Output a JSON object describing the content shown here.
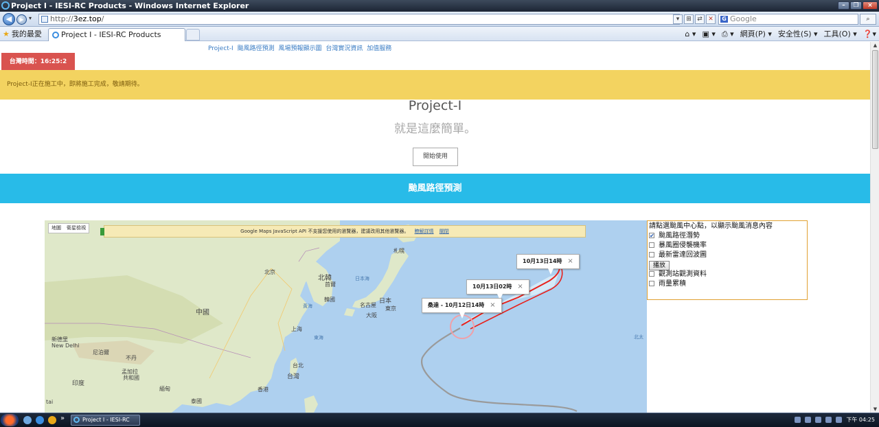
{
  "window": {
    "title": "Project I - IESI-RC Products - Windows Internet Explorer",
    "minimize": "–",
    "restore": "❐",
    "close": "×"
  },
  "browser": {
    "back_icon": "◀",
    "forward_icon": "▶",
    "address_prefix": "http://",
    "address_host": "3ez.top",
    "address_suffix": "/",
    "address_buttons": [
      "▾",
      "⊞",
      "⇄",
      "✕"
    ],
    "search_placeholder": "Google",
    "search_go": "⌕",
    "favorites_label": "我的最愛",
    "tab_title": "Project I - IESI-RC Products",
    "command_items": [
      "網頁(P) ▾",
      "安全性(S) ▾",
      "工具(O) ▾",
      "❓▾"
    ]
  },
  "page": {
    "top_nav": [
      "Project-I",
      "颱風路徑預測",
      "風場預報顯示圖",
      "台灣實況資訊",
      "加值服務"
    ],
    "clock": "台灣時間：16:25:2",
    "notice": "Project-I正在施工中，即將施工完成，敬請期待。",
    "hero_title": "Project-I",
    "hero_subtitle": "就是這麼簡單。",
    "start_button": "開始使用",
    "section_title": "颱風路徑預測"
  },
  "map": {
    "type_map": "地圖",
    "type_satellite": "衛星檢視",
    "warning": "Google Maps JavaScript API 不支援您使用的瀏覽器，建議改用其他瀏覽器。",
    "warning_link1": "瞭解詳情",
    "warning_link2": "關閉",
    "labels": {
      "china": "中國",
      "beijing": "北京",
      "north_korea": "北韓",
      "seoul": "首爾",
      "south_korea": "韓國",
      "japan": "日本",
      "tokyo": "東京",
      "nagoya": "名古屋",
      "osaka": "大阪",
      "sapporo": "札幌",
      "shanghai": "上海",
      "taipei": "台北",
      "taiwan": "台灣",
      "hongkong": "香港",
      "india": "印度",
      "newdelhi_zh": "新德里",
      "newdelhi_en": "New Delhi",
      "bangladesh": "孟加拉",
      "bangladesh2": "人民",
      "bangladesh3": "共和國",
      "myanmar": "緬甸",
      "thailand": "泰國",
      "nepal": "尼泊爾",
      "bhutan": "不丹",
      "tibet": "西藏",
      "pingan": "平安",
      "sea_japan": "日本海",
      "sea_yellow": "黃海",
      "sea_east": "東海",
      "pacific": "北太",
      "tai": "tai"
    },
    "infobox": [
      {
        "text": "10月13日14時"
      },
      {
        "text": "10月13日02時"
      },
      {
        "text": "桑達 - 10月12日14時"
      }
    ],
    "close_glyph": "×",
    "colors": {
      "track_forecast": "#e8211b",
      "track_past": "#9a9a9a",
      "current_circle": "#f0a0a8"
    }
  },
  "panel": {
    "heading": "請點選颱風中心點，以顯示颱風消息內容",
    "options": [
      {
        "label": "颱風路徑潛勢",
        "checked": true
      },
      {
        "label": "暴風圈侵襲機率",
        "checked": false
      },
      {
        "label": "最新雷達回波圖",
        "checked": false
      }
    ],
    "play_button": "播放",
    "options2": [
      {
        "label": "觀測站觀測資料",
        "checked": false
      },
      {
        "label": "雨量累積",
        "checked": false
      }
    ],
    "check_glyph": "✔"
  },
  "taskbar": {
    "task_title": "Project I - IESI-RC Pro...",
    "more": "»",
    "time": "下午 04:25"
  }
}
